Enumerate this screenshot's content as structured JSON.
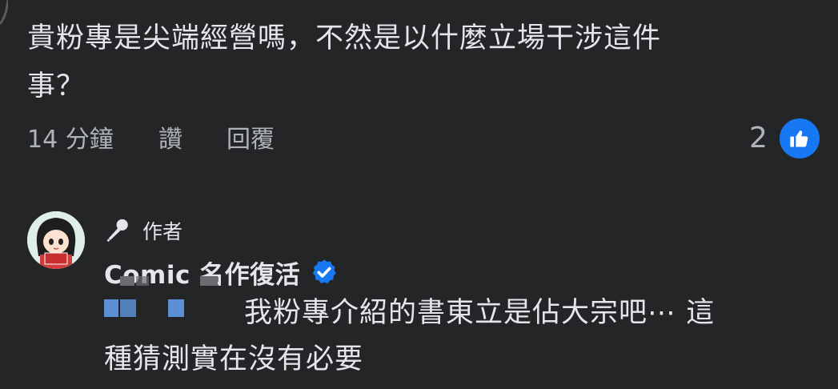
{
  "comment": {
    "text_line1": "貴粉專是尖端經營嗎，不然是以什麼立場干涉這件",
    "text_line2": "事？",
    "time": "14 分鐘",
    "like_label": "讚",
    "reply_label": "回覆",
    "reaction_count": "2",
    "reaction_icon": "thumbs-up-icon"
  },
  "reply": {
    "author_badge": "作者",
    "author_badge_icon": "microphone-icon",
    "author_name": "Comic 名作復活",
    "verified_icon": "verified-badge-icon",
    "text_line1": "我粉專介紹的書東立是佔大宗吧⋯ 這",
    "text_line2": "種猜測實在沒有必要"
  },
  "colors": {
    "background": "#242526",
    "text": "#e4e6eb",
    "secondary": "#b0b3b8",
    "accent": "#1877f2"
  }
}
